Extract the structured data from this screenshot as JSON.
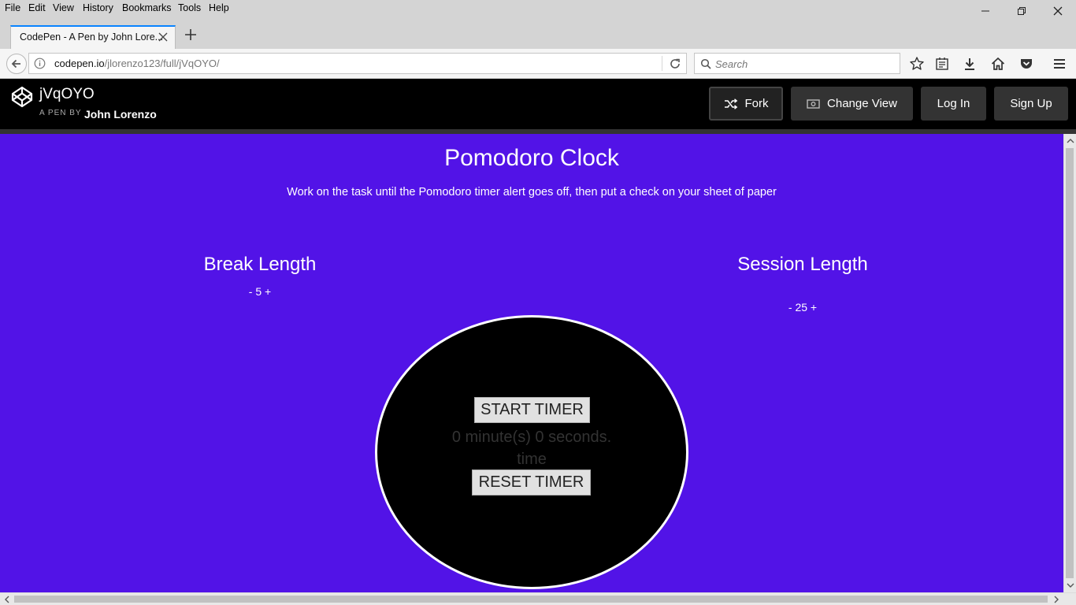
{
  "browser": {
    "menu": [
      "File",
      "Edit",
      "View",
      "History",
      "Bookmarks",
      "Tools",
      "Help"
    ],
    "tab_title": "CodePen - A Pen by John Lore...",
    "url_host": "codepen.io",
    "url_path": "/jlorenzo123/full/jVqOYO/",
    "search_placeholder": "Search"
  },
  "codepen": {
    "pen_title": "jVqOYO",
    "by_label": "A PEN BY",
    "author": "John Lorenzo",
    "buttons": {
      "fork": "Fork",
      "change_view": "Change View",
      "login": "Log In",
      "signup": "Sign Up"
    }
  },
  "app": {
    "title": "Pomodoro Clock",
    "subtitle": "Work on the task until the Pomodoro timer alert goes off, then put a check on your sheet of paper",
    "break": {
      "label": "Break Length",
      "minus": "-",
      "value": "5",
      "plus": "+"
    },
    "session": {
      "label": "Session Length",
      "minus": "-",
      "value": "25",
      "plus": "+"
    },
    "timer": {
      "start_label": "START TIMER",
      "time_text": "0 minute(s) 0 seconds.",
      "mode_text": "time",
      "reset_label": "RESET TIMER"
    }
  },
  "colors": {
    "background": "#5213e7",
    "clock_face": "#000000",
    "clock_border": "#ffffff",
    "header": "#000000"
  }
}
